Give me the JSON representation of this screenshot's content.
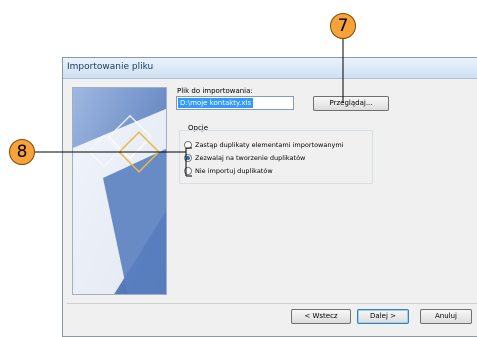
{
  "dialog": {
    "title": "Importowanie pliku",
    "file_label": "Plik do importowania:",
    "file_value": "D:\\moje kontakty.xls",
    "browse_label": "Przeglądaj...",
    "options_label": "Opcje",
    "options": [
      {
        "label": "Zastąp duplikaty elementami importowanymi",
        "selected": false
      },
      {
        "label": "Zezwalaj na tworzenie duplikatów",
        "selected": true
      },
      {
        "label": "Nie importuj duplikatów",
        "selected": false
      }
    ],
    "back_label": "< Wstecz",
    "next_label": "Dalej >",
    "cancel_label": "Anuluj"
  },
  "callouts": {
    "browse": "7",
    "options": "8"
  },
  "colors": {
    "callout": "#f7a23b",
    "accent": "#3399ff"
  }
}
